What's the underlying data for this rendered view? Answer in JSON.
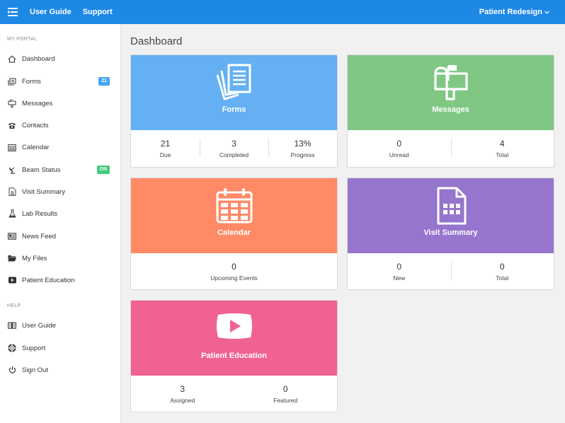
{
  "topbar": {
    "links": [
      "User Guide",
      "Support"
    ],
    "user_menu": "Patient Redesign"
  },
  "sidebar": {
    "sections": [
      "MY PORTAL",
      "HELP"
    ],
    "items": [
      {
        "label": "Dashboard",
        "icon": "home-icon"
      },
      {
        "label": "Forms",
        "icon": "forms-icon",
        "badge": "21"
      },
      {
        "label": "Messages",
        "icon": "mailbox-icon"
      },
      {
        "label": "Contacts",
        "icon": "phone-icon"
      },
      {
        "label": "Calendar",
        "icon": "calendar-icon"
      },
      {
        "label": "Beam Status",
        "icon": "satellite-icon",
        "badge": "ON"
      },
      {
        "label": "Visit Summary",
        "icon": "document-icon"
      },
      {
        "label": "Lab Results",
        "icon": "flask-icon"
      },
      {
        "label": "News Feed",
        "icon": "newspaper-icon"
      },
      {
        "label": "My Files",
        "icon": "folder-icon"
      },
      {
        "label": "Patient Education",
        "icon": "play-icon"
      }
    ],
    "help_items": [
      {
        "label": "User Guide",
        "icon": "book-icon"
      },
      {
        "label": "Support",
        "icon": "lifebuoy-icon"
      },
      {
        "label": "Sign Out",
        "icon": "power-icon"
      }
    ]
  },
  "main": {
    "title": "Dashboard",
    "cards": [
      {
        "title": "Forms",
        "color": "#64b0f2",
        "icon": "forms-icon",
        "stats": [
          {
            "value": "21",
            "label": "Due"
          },
          {
            "value": "3",
            "label": "Completed"
          },
          {
            "value": "13%",
            "label": "Progress"
          }
        ]
      },
      {
        "title": "Messages",
        "color": "#81c784",
        "icon": "mailbox-icon",
        "stats": [
          {
            "value": "0",
            "label": "Unread"
          },
          {
            "value": "4",
            "label": "Total"
          }
        ]
      },
      {
        "title": "Calendar",
        "color": "#ff8a65",
        "icon": "calendar-icon",
        "stats": [
          {
            "value": "0",
            "label": "Upcoming Events"
          }
        ]
      },
      {
        "title": "Visit Summary",
        "color": "#9575cd",
        "icon": "document-icon",
        "stats": [
          {
            "value": "0",
            "label": "New"
          },
          {
            "value": "0",
            "label": "Total"
          }
        ]
      },
      {
        "title": "Patient Education",
        "color": "#f06292",
        "icon": "play-icon",
        "stats": [
          {
            "value": "3",
            "label": "Assigned"
          },
          {
            "value": "0",
            "label": "Featured"
          }
        ]
      }
    ]
  },
  "colors": {
    "topbar": "#1e88e5",
    "badge_blue": "#42a5f5",
    "badge_green": "#43c97a"
  }
}
